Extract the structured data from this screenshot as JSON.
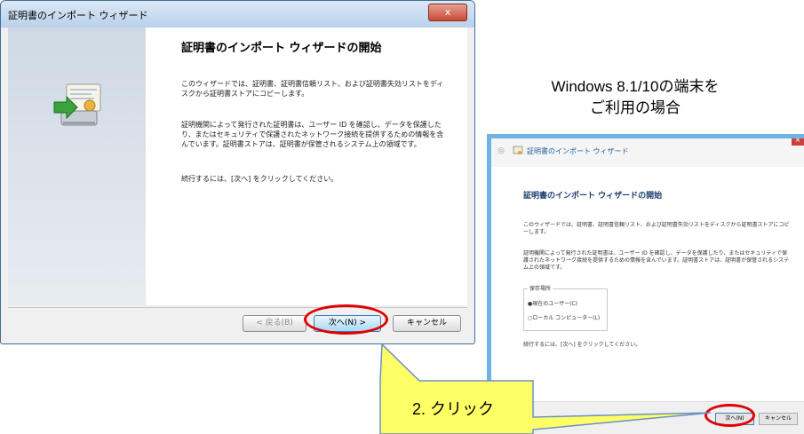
{
  "win7_wizard": {
    "window_title": "証明書のインポート ウィザード",
    "close_glyph": "x",
    "heading": "証明書のインポート ウィザードの開始",
    "paragraph1": "このウィザードでは、証明書、証明書信頼リスト、および証明書失効リストをディスクから証明書ストアにコピーします。",
    "paragraph2": "証明機関によって発行された証明書は、ユーザー ID を確認し、データを保護したり、またはセキュリティで保護されたネットワーク接続を提供するための情報を含んでいます。証明書ストアは、証明書が保管されるシステム上の領域です。",
    "paragraph3": "続行するには、[次へ] をクリックしてください。",
    "buttons": {
      "back": "< 戻る(B)",
      "next": "次へ(N) >",
      "cancel": "キャンセル"
    }
  },
  "caption": {
    "line1": "Windows 8.1/10の端末を",
    "line2": "ご利用の場合"
  },
  "win8_wizard": {
    "back_glyph": "◎",
    "close_glyph": "×",
    "window_title": "証明書のインポート ウィザード",
    "heading": "証明書のインポート ウィザードの開始",
    "paragraph1": "このウィザードでは、証明書、証明書信頼リスト、および証明書失効リストをディスクから証明書ストアにコピーします。",
    "paragraph2": "証明機関によって発行された証明書は、ユーザー ID を確認し、データを保護したり、またはセキュリティで保護されたネットワーク接続を提供するための情報を含んでいます。証明書ストアは、証明書が保管されるシステム上の領域です。",
    "store_group_label": "保存場所",
    "radio_current_user": "●現在のユーザー(C)",
    "radio_local_machine": "○ローカル コンピューター(L)",
    "paragraph3": "続行するには、[次へ] をクリックしてください。",
    "buttons": {
      "next": "次へ(N)",
      "cancel": "キャンセル"
    }
  },
  "callout": {
    "text": "2. クリック"
  },
  "colors": {
    "highlight_ring": "#e00000",
    "callout_fill": "#ffff66",
    "callout_border": "#6a90c4"
  }
}
